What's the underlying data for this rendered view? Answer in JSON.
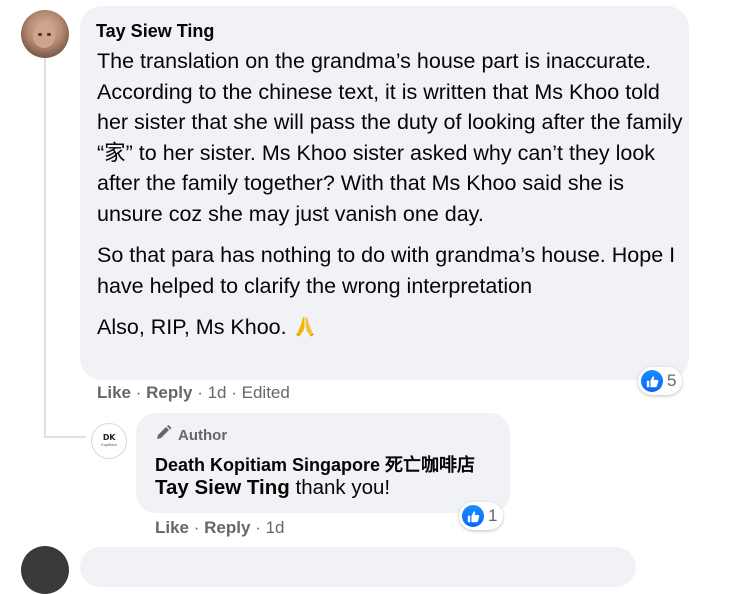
{
  "comment": {
    "author": "Tay Siew Ting",
    "paragraphs": [
      "The translation on the grandma’s house part is inaccurate. According to the chinese text, it is written that Ms Khoo told her sister that she will pass the duty of looking after the family “家” to her sister. Ms Khoo sister asked why can’t they look after the family together? With that Ms Khoo said she is unsure coz she may just vanish one day.",
      "So that para has nothing to do with grandma’s house. Hope I have helped to clarify the wrong interpretation",
      "Also, RIP, Ms Khoo."
    ],
    "actions": {
      "like": "Like",
      "reply": "Reply"
    },
    "time": "1d",
    "edited": "Edited",
    "reaction_count": "5",
    "emoji_icon": "folded-hands-icon"
  },
  "reply": {
    "badge": "Author",
    "author": "Death Kopitiam Singapore 死亡咖啡店",
    "avatar_logo_top": "DK",
    "avatar_logo_bottom": "Kopitiam",
    "mention": "Tay Siew Ting",
    "text": " thank you!",
    "actions": {
      "like": "Like",
      "reply": "Reply"
    },
    "time": "1d",
    "reaction_count": "1"
  },
  "colors": {
    "bubble": "#f0f2f5",
    "meta": "#65676b",
    "like_blue": "#0866ff"
  }
}
